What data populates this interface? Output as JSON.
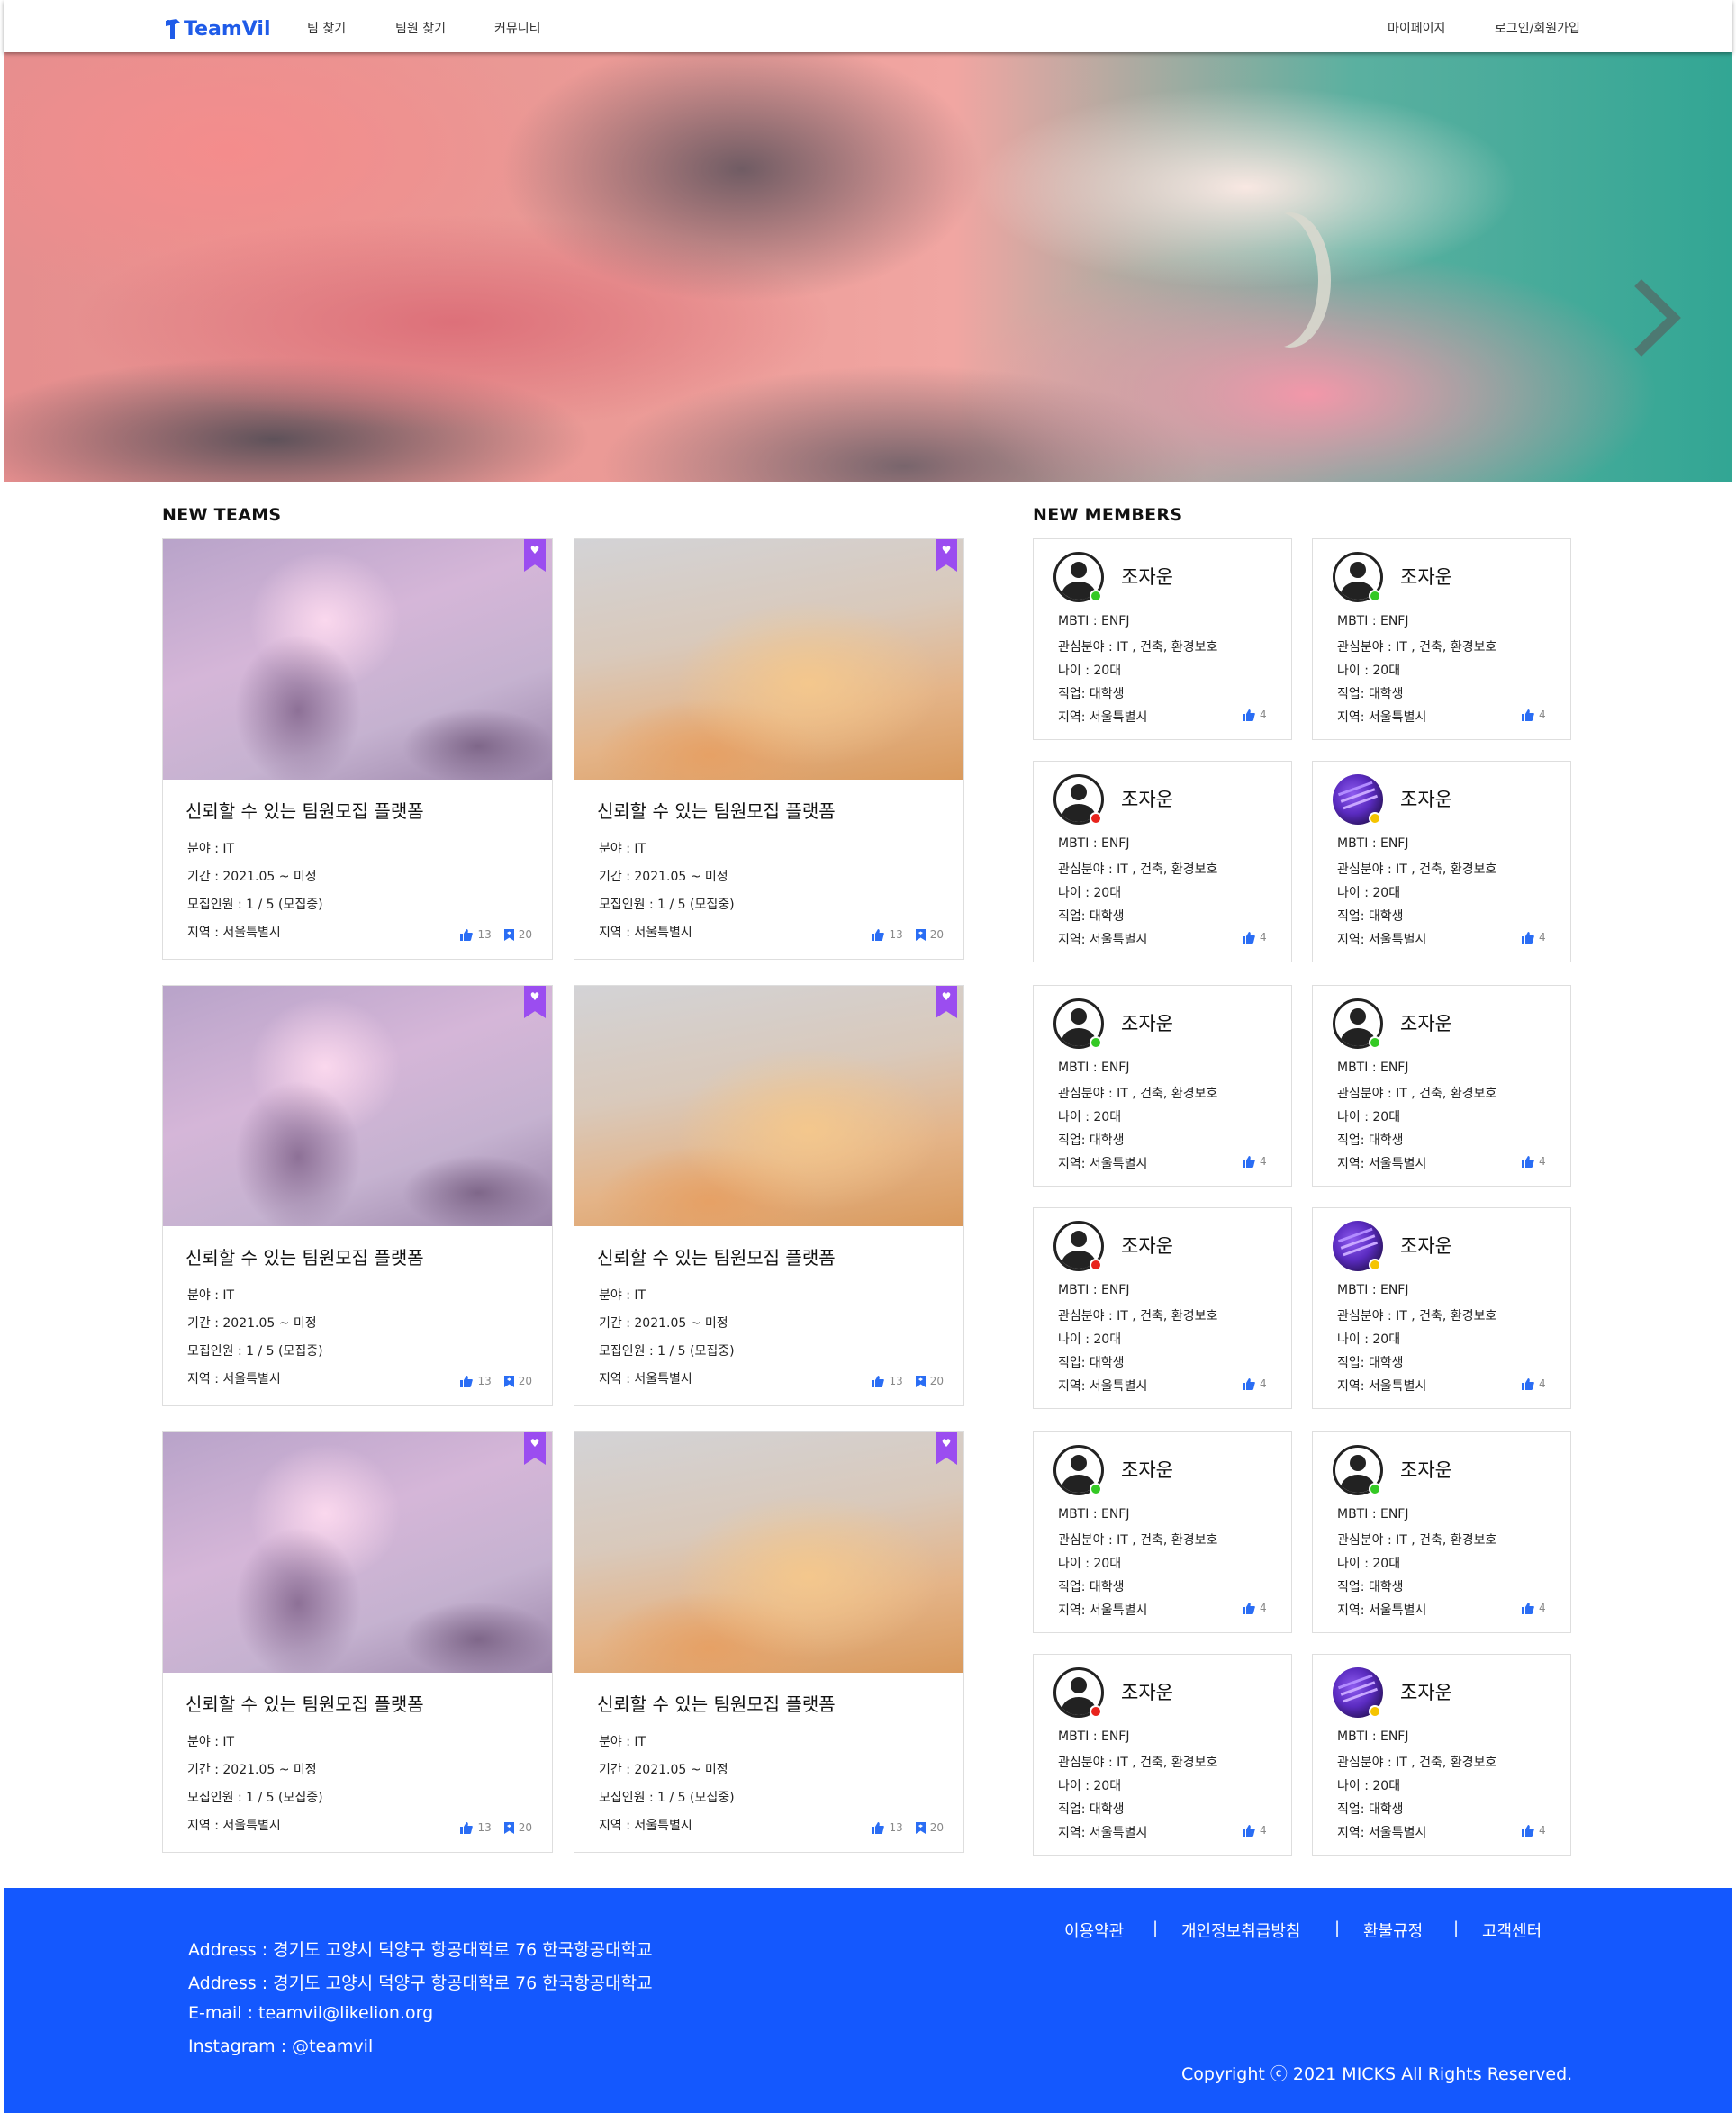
{
  "header": {
    "logo": "TeamVil",
    "nav": [
      "팀 찾기",
      "팀원 찾기",
      "커뮤니티"
    ],
    "right": [
      "마이페이지",
      "로그인/회원가입"
    ]
  },
  "sections": {
    "new_teams": "NEW TEAMS",
    "new_members": "NEW MEMBERS"
  },
  "teams": [
    {
      "title": "신뢰할 수 있는 팀원모집 플랫폼",
      "field": "분야 : IT",
      "period": "기간 : 2021.05 ~ 미정",
      "recruit": "모집인원 : 1 / 5 (모집중)",
      "region": "지역 : 서울특별시",
      "likes": "13",
      "bookmarks": "20",
      "image": "pink-clouds"
    },
    {
      "title": "신뢰할 수 있는 팀원모집 플랫폼",
      "field": "분야 : IT",
      "period": "기간 : 2021.05 ~ 미정",
      "recruit": "모집인원 : 1 / 5 (모집중)",
      "region": "지역 : 서울특별시",
      "likes": "13",
      "bookmarks": "20",
      "image": "orange-clouds"
    },
    {
      "title": "신뢰할 수 있는 팀원모집 플랫폼",
      "field": "분야 : IT",
      "period": "기간 : 2021.05 ~ 미정",
      "recruit": "모집인원 : 1 / 5 (모집중)",
      "region": "지역 : 서울특별시",
      "likes": "13",
      "bookmarks": "20",
      "image": "pink-clouds"
    },
    {
      "title": "신뢰할 수 있는 팀원모집 플랫폼",
      "field": "분야 : IT",
      "period": "기간 : 2021.05 ~ 미정",
      "recruit": "모집인원 : 1 / 5 (모집중)",
      "region": "지역 : 서울특별시",
      "likes": "13",
      "bookmarks": "20",
      "image": "orange-clouds"
    },
    {
      "title": "신뢰할 수 있는 팀원모집 플랫폼",
      "field": "분야 : IT",
      "period": "기간 : 2021.05 ~ 미정",
      "recruit": "모집인원 : 1 / 5 (모집중)",
      "region": "지역 : 서울특별시",
      "likes": "13",
      "bookmarks": "20",
      "image": "pink-clouds"
    },
    {
      "title": "신뢰할 수 있는 팀원모집 플랫폼",
      "field": "분야 : IT",
      "period": "기간 : 2021.05 ~ 미정",
      "recruit": "모집인원 : 1 / 5 (모집중)",
      "region": "지역 : 서울특별시",
      "likes": "13",
      "bookmarks": "20",
      "image": "orange-clouds"
    }
  ],
  "members": [
    {
      "name": "조자운",
      "mbti": "MBTI : ENFJ",
      "interest": "관심분야 : IT , 건축, 환경보호",
      "age": "나이 : 20대",
      "job": "직업: 대학생",
      "region": "지역: 서울특별시",
      "likes": "4",
      "avatar": "default",
      "status": "green"
    },
    {
      "name": "조자운",
      "mbti": "MBTI : ENFJ",
      "interest": "관심분야 : IT , 건축, 환경보호",
      "age": "나이 : 20대",
      "job": "직업: 대학생",
      "region": "지역: 서울특별시",
      "likes": "4",
      "avatar": "default",
      "status": "green"
    },
    {
      "name": "조자운",
      "mbti": "MBTI : ENFJ",
      "interest": "관심분야 : IT , 건축, 환경보호",
      "age": "나이 : 20대",
      "job": "직업: 대학생",
      "region": "지역: 서울특별시",
      "likes": "4",
      "avatar": "default",
      "status": "red"
    },
    {
      "name": "조자운",
      "mbti": "MBTI : ENFJ",
      "interest": "관심분야 : IT , 건축, 환경보호",
      "age": "나이 : 20대",
      "job": "직업: 대학생",
      "region": "지역: 서울특별시",
      "likes": "4",
      "avatar": "photo",
      "status": "yellow"
    },
    {
      "name": "조자운",
      "mbti": "MBTI : ENFJ",
      "interest": "관심분야 : IT , 건축, 환경보호",
      "age": "나이 : 20대",
      "job": "직업: 대학생",
      "region": "지역: 서울특별시",
      "likes": "4",
      "avatar": "default",
      "status": "green"
    },
    {
      "name": "조자운",
      "mbti": "MBTI : ENFJ",
      "interest": "관심분야 : IT , 건축, 환경보호",
      "age": "나이 : 20대",
      "job": "직업: 대학생",
      "region": "지역: 서울특별시",
      "likes": "4",
      "avatar": "default",
      "status": "green"
    },
    {
      "name": "조자운",
      "mbti": "MBTI : ENFJ",
      "interest": "관심분야 : IT , 건축, 환경보호",
      "age": "나이 : 20대",
      "job": "직업: 대학생",
      "region": "지역: 서울특별시",
      "likes": "4",
      "avatar": "default",
      "status": "red"
    },
    {
      "name": "조자운",
      "mbti": "MBTI : ENFJ",
      "interest": "관심분야 : IT , 건축, 환경보호",
      "age": "나이 : 20대",
      "job": "직업: 대학생",
      "region": "지역: 서울특별시",
      "likes": "4",
      "avatar": "photo",
      "status": "yellow"
    },
    {
      "name": "조자운",
      "mbti": "MBTI : ENFJ",
      "interest": "관심분야 : IT , 건축, 환경보호",
      "age": "나이 : 20대",
      "job": "직업: 대학생",
      "region": "지역: 서울특별시",
      "likes": "4",
      "avatar": "default",
      "status": "green"
    },
    {
      "name": "조자운",
      "mbti": "MBTI : ENFJ",
      "interest": "관심분야 : IT , 건축, 환경보호",
      "age": "나이 : 20대",
      "job": "직업: 대학생",
      "region": "지역: 서울특별시",
      "likes": "4",
      "avatar": "default",
      "status": "green"
    },
    {
      "name": "조자운",
      "mbti": "MBTI : ENFJ",
      "interest": "관심분야 : IT , 건축, 환경보호",
      "age": "나이 : 20대",
      "job": "직업: 대학생",
      "region": "지역: 서울특별시",
      "likes": "4",
      "avatar": "default",
      "status": "red"
    },
    {
      "name": "조자운",
      "mbti": "MBTI : ENFJ",
      "interest": "관심분야 : IT , 건축, 환경보호",
      "age": "나이 : 20대",
      "job": "직업: 대학생",
      "region": "지역: 서울특별시",
      "likes": "4",
      "avatar": "photo",
      "status": "yellow"
    }
  ],
  "footer": {
    "lines": [
      "Address : 경기도 고양시 덕양구 항공대학로 76 한국항공대학교",
      "Address : 경기도 고양시 덕양구 항공대학로 76 한국항공대학교",
      "E-mail : teamvil@likelion.org",
      "Instagram : @teamvil"
    ],
    "links": [
      "이용약관",
      "개인정보취급방침",
      "환불규정",
      "고객센터"
    ],
    "separator": "|",
    "copyright": "Copyright ⓒ 2021 MICKS All Rights Reserved."
  },
  "colors": {
    "brand_blue": "#1458fe",
    "logo_blue": "#1f5be8",
    "bookmark_purple": "#9b4df0",
    "icon_blue": "#2a6df4",
    "status_green": "#34c924",
    "status_red": "#e8231c",
    "status_yellow": "#f5c400"
  },
  "icons": {
    "hero_next": "chevron-right-icon",
    "bookmark": "heart-bookmark-icon",
    "like": "thumbs-up-icon",
    "save": "bookmark-icon",
    "avatar_default": "user-circle-icon"
  }
}
